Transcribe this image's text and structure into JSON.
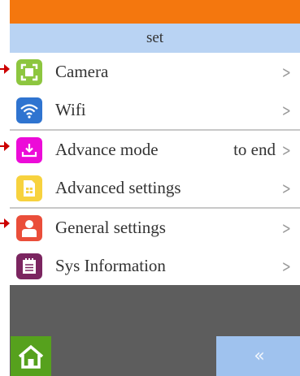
{
  "header": {
    "title": "set"
  },
  "menu": {
    "items": [
      {
        "label": "Camera",
        "icon": "camera-frame-icon",
        "icon_color": "#8dc63f"
      },
      {
        "label": "Wifi",
        "icon": "wifi-icon",
        "icon_color": "#2f74d0"
      },
      {
        "label": "Advance mode",
        "value": "to end",
        "icon": "download-tray-icon",
        "icon_color": "#ec0bd8"
      },
      {
        "label": "Advanced settings",
        "icon": "sim-card-icon",
        "icon_color": "#f7d23e"
      },
      {
        "label": "General settings",
        "icon": "user-icon",
        "icon_color": "#ea4e3a"
      },
      {
        "label": "Sys Information",
        "icon": "calendar-list-icon",
        "icon_color": "#7b2560"
      }
    ],
    "chevron": ">"
  },
  "footer": {
    "home_icon": "home-icon",
    "back_label": "«"
  },
  "colors": {
    "status_bar": "#f4770e",
    "title_bar": "#b9d3f3",
    "background": "#5d5d5d",
    "home_button": "#56a11d",
    "back_button": "#9fc2ee",
    "pointer": "#cc0000"
  }
}
